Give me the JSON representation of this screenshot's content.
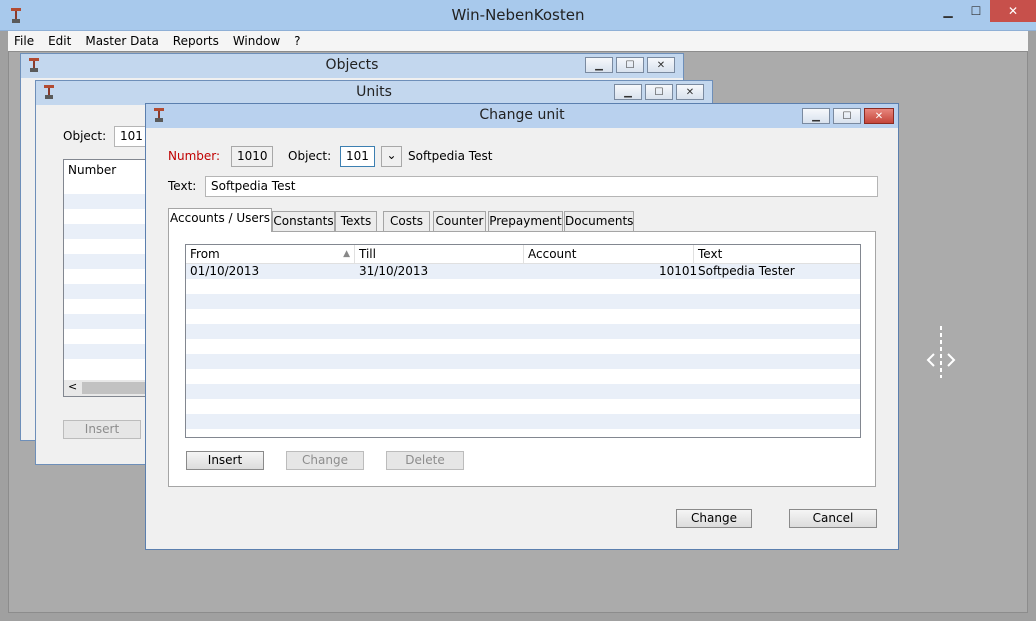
{
  "window": {
    "title": "Win-NebenKosten",
    "min": "▁",
    "max": "☐",
    "close": "✕"
  },
  "menu": [
    "File",
    "Edit",
    "Master Data",
    "Reports",
    "Window",
    "?"
  ],
  "objects_window": {
    "title": "Objects"
  },
  "units_window": {
    "title": "Units",
    "object_label": "Object:",
    "object_value": "101",
    "column_number": "Number",
    "scroll_left": "<",
    "insert_label": "Insert"
  },
  "dialog": {
    "title": "Change unit",
    "number_label": "Number:",
    "number_value": "1010",
    "object_label": "Object:",
    "object_value": "101",
    "object_dropdown": "⌄",
    "object_name": "Softpedia Test",
    "text_label": "Text:",
    "text_value": "Softpedia Test",
    "tabs": [
      "Accounts / Users",
      "Constants",
      "Texts",
      "Costs",
      "Counter",
      "Prepayment",
      "Documents"
    ],
    "grid": {
      "columns": [
        "From",
        "Till",
        "Account",
        "Text"
      ],
      "sort_indicator": "▲",
      "rows": [
        [
          "01/10/2013",
          "31/10/2013",
          "10101",
          "Softpedia Tester"
        ]
      ]
    },
    "insert_label": "Insert",
    "change_label": "Change",
    "delete_label": "Delete",
    "ok_label": "Change",
    "cancel_label": "Cancel"
  },
  "colors": {
    "accent": "#3c7fb1",
    "label_red": "#c00000",
    "close_red": "#c7504b"
  }
}
